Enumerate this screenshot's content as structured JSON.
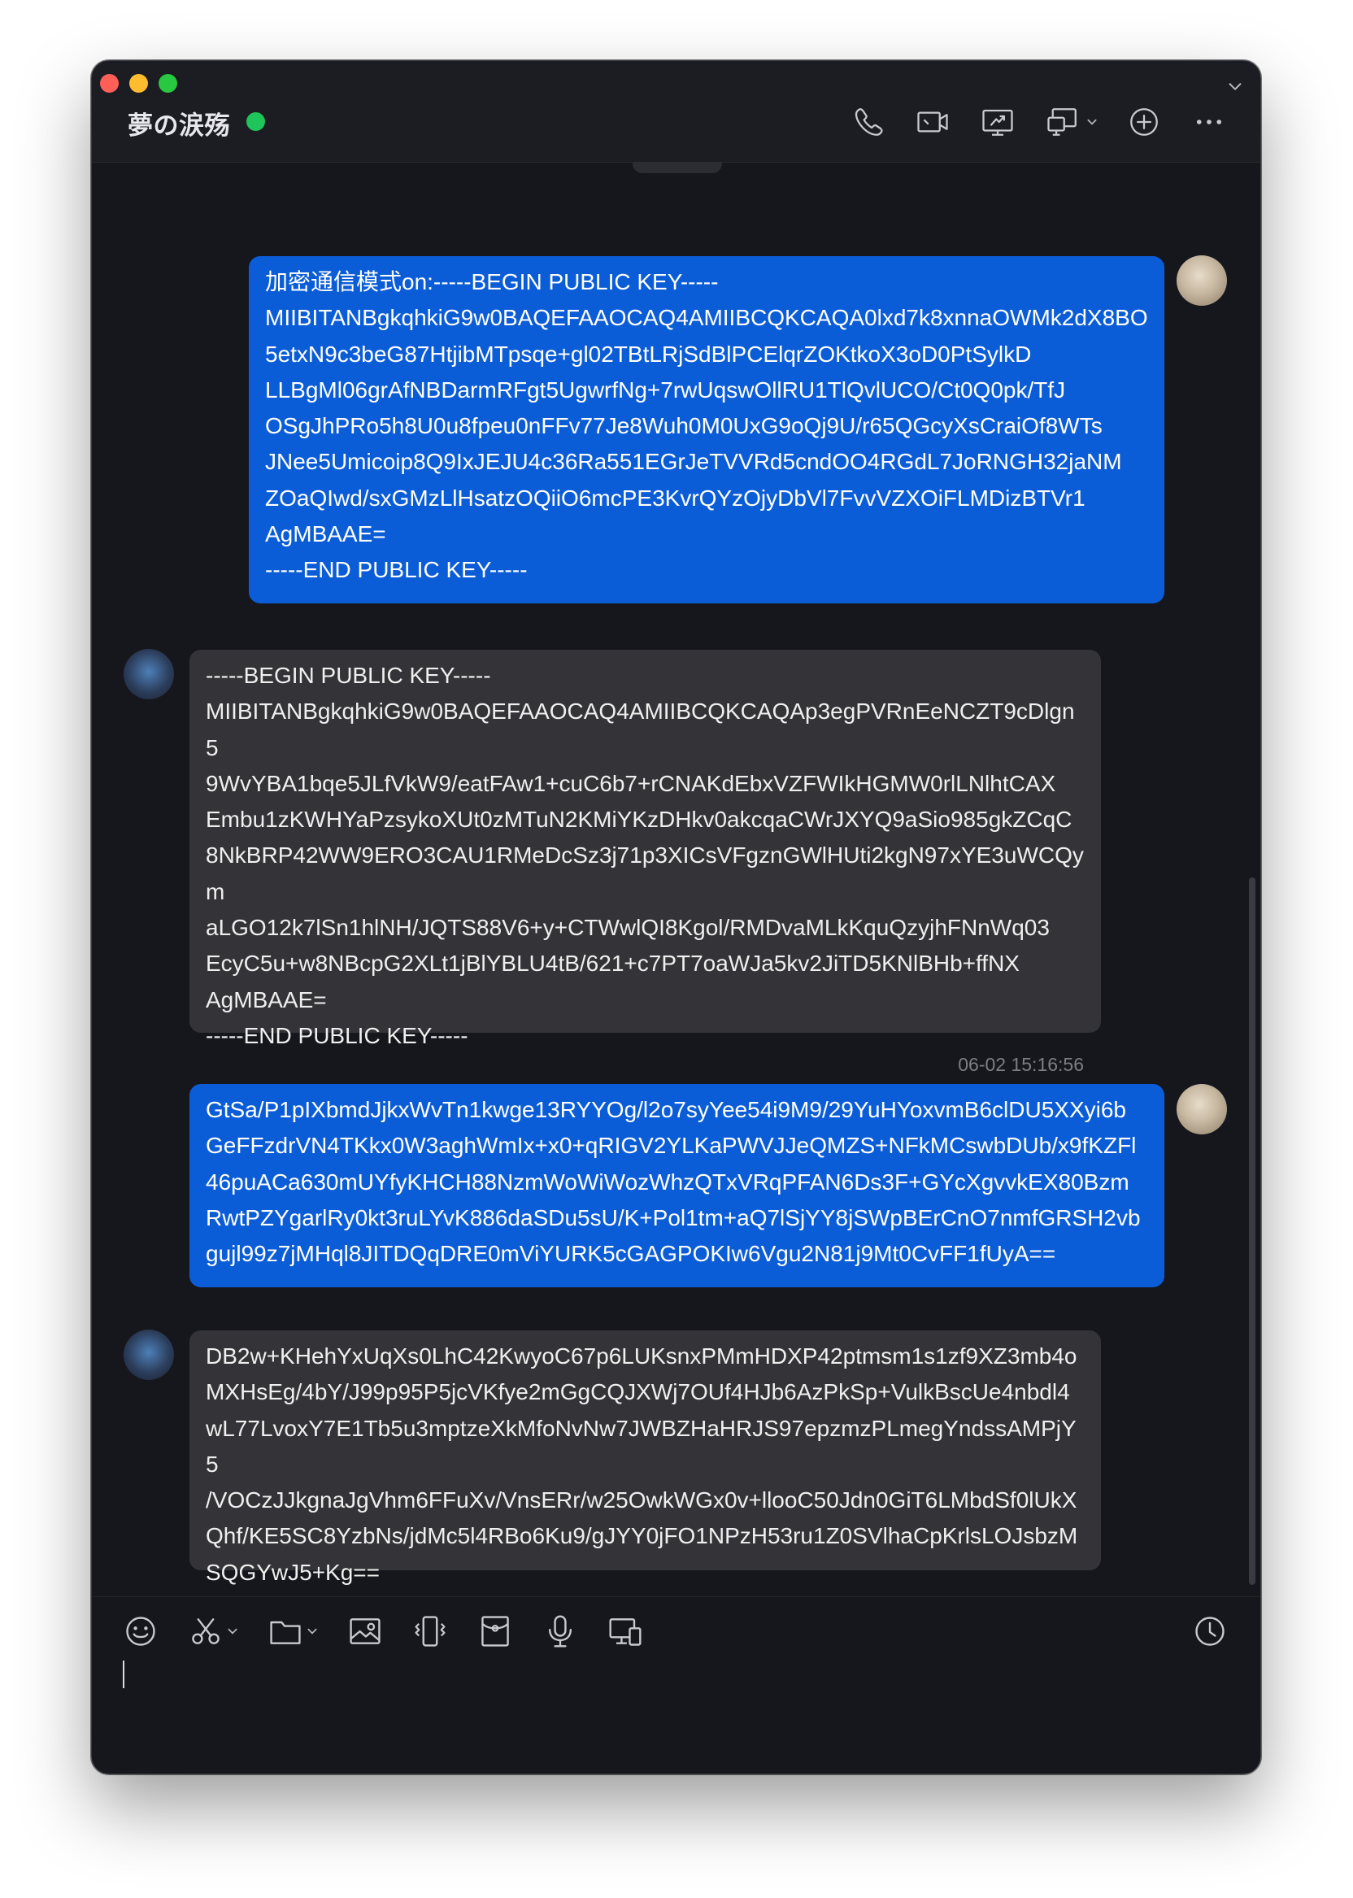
{
  "window": {
    "title": "夢の涙殇",
    "online_status": "online"
  },
  "toolbar": {
    "icons": [
      "phone-icon",
      "video-call-icon",
      "screen-share-icon",
      "remote-assist-icon",
      "add-member-icon",
      "more-icon"
    ]
  },
  "messages": [
    {
      "direction": "out",
      "text": "加密通信模式on:-----BEGIN PUBLIC KEY-----\nMIIBITANBgkqhkiG9w0BAQEFAAOCAQ4AMIIBCQKCAQA0lxd7k8xnnaOWMk2dX8BO\n5etxN9c3beG87HtjibMTpsqe+gl02TBtLRjSdBlPCElqrZOKtkoX3oD0PtSylkD\nLLBgMl06grAfNBDarmRFgt5UgwrfNg+7rwUqswOllRU1TlQvlUCO/Ct0Q0pk/TfJ\nOSgJhPRo5h8U0u8fpeu0nFFv77Je8Wuh0M0UxG9oQj9U/r65QGcyXsCraiOf8WTs\nJNee5Umicoip8Q9IxJEJU4c36Ra551EGrJeTVVRd5cndOO4RGdL7JoRNGH32jaNM\nZOaQIwd/sxGMzLlHsatzOQiiO6mcPE3KvrQYzOjyDbVl7FvvVZXOiFLMDizBTVr1\nAgMBAAE=\n-----END PUBLIC KEY-----"
    },
    {
      "direction": "in",
      "text": "-----BEGIN PUBLIC KEY-----\nMIIBITANBgkqhkiG9w0BAQEFAAOCAQ4AMIIBCQKCAQAp3egPVRnEeNCZT9cDlgn5\n9WvYBA1bqe5JLfVkW9/eatFAw1+cuC6b7+rCNAKdEbxVZFWIkHGMW0rlLNlhtCAX\nEmbu1zKWHYaPzsykoXUt0zMTuN2KMiYKzDHkv0akcqaCWrJXYQ9aSio985gkZCqC\n8NkBRP42WW9ERO3CAU1RMeDcSz3j71p3XICsVFgznGWlHUti2kgN97xYE3uWCQy\nm\naLGO12k7lSn1hlNH/JQTS88V6+y+CTWwlQI8Kgol/RMDvaMLkKquQzyjhFNnWq03\nEcyC5u+w8NBcpG2XLt1jBlYBLU4tB/621+c7PT7oaWJa5kv2JiTD5KNlBHb+ffNX\nAgMBAAE=\n-----END PUBLIC KEY-----"
    },
    {
      "direction": "out",
      "timestamp": "06-02 15:16:56",
      "text": "GtSa/P1pIXbmdJjkxWvTn1kwge13RYYOg/l2o7syYee54i9M9/29YuHYoxvmB6clDU5XXyi6b\nGeFFzdrVN4TKkx0W3aghWmIx+x0+qRIGV2YLKaPWVJJeQMZS+NFkMCswbDUb/x9fKZFl\n46puACa630mUYfyKHCH88NzmWoWiWozWhzQTxVRqPFAN6Ds3F+GYcXgvvkEX80Bzm\nRwtPZYgarlRy0kt3ruLYvK886daSDu5sU/K+Pol1tm+aQ7lSjYY8jSWpBErCnO7nmfGRSH2vb\ngujl99z7jMHql8JITDQqDRE0mViYURK5cGAGPOKIw6Vgu2N81j9Mt0CvFF1fUyA=="
    },
    {
      "direction": "in",
      "text": "DB2w+KHehYxUqXs0LhC42KwyoC67p6LUKsnxPMmHDXP42ptmsm1s1zf9XZ3mb4o\nMXHsEg/4bY/J99p95P5jcVKfye2mGgCQJXWj7OUf4HJb6AzPkSp+VulkBscUe4nbdl4\nwL77LvoxY7E1Tb5u3mptzeXkMfoNvNw7JWBZHaHRJS97epzmzPLmegYndssAMPjY5\n/VOCzJJkgnaJgVhm6FFuXv/VnsERr/w25OwkWGx0v+llooC50Jdn0GiT6LMbdSf0lUkX\nQhf/KE5SC8YzbNs/jdMc5l4RBo6Ku9/gJYY0jFO1NPzH53ru1Z0SVlhaCpKrlsLOJsbzM\nSQGYwJ5+Kg=="
    }
  ],
  "input_toolbar": {
    "icons": [
      "emoji-icon",
      "scissors-icon",
      "folder-icon",
      "image-icon",
      "vibrate-icon",
      "red-packet-icon",
      "microphone-icon",
      "screen-share-icon"
    ],
    "history_icon": "clock-icon"
  }
}
